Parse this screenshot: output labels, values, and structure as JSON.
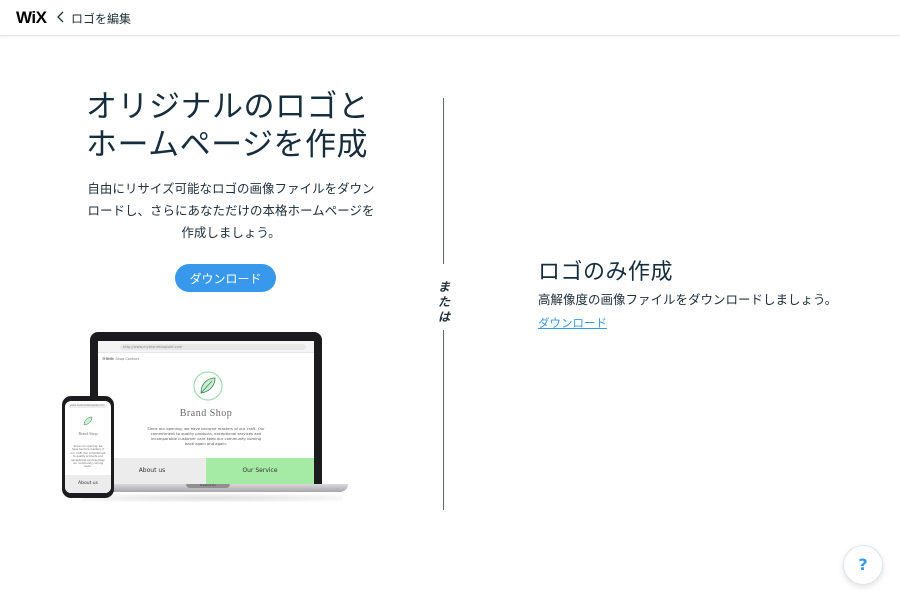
{
  "header": {
    "brand": "WiX",
    "back_label": "ロゴを編集"
  },
  "left": {
    "title_line1": "オリジナルのロゴと",
    "title_line2": "ホームページを作成",
    "description": "自由にリサイズ可能なロゴの画像ファイルをダウンロードし、さらにあなただけの本格ホームページを作成しましょう。",
    "download_button": "ダウンロード"
  },
  "illustration": {
    "laptop_url": "http://www.mybrandshopsite.com",
    "site_nav": "Home  Shop  Contact",
    "brand_name": "Brand Shop",
    "brand_copy": "Since our opening, we have become masters of our craft. Our commitment to quality products, exceptional services and incomparable customer care keep our community coming back again and again.",
    "about_button": "About us",
    "service_button": "Our Service",
    "laptop_model": "MacBook Pro",
    "phone_url": "www.mybrandshopsite.com",
    "phone_brand": "Brand Shop",
    "phone_copy": "Since our opening, we have become masters of our craft. Our commitment to quality products and exceptional services keep our community coming back.",
    "phone_button": "About us"
  },
  "divider": {
    "or_label": "または"
  },
  "right": {
    "title": "ロゴのみ作成",
    "description": "高解像度の画像ファイルをダウンロードしましょう。",
    "download_link": "ダウンロード"
  },
  "help": {
    "label": "?"
  },
  "colors": {
    "accent": "#3899ec",
    "text": "#162d3d",
    "service_green": "#a5eaa5"
  }
}
